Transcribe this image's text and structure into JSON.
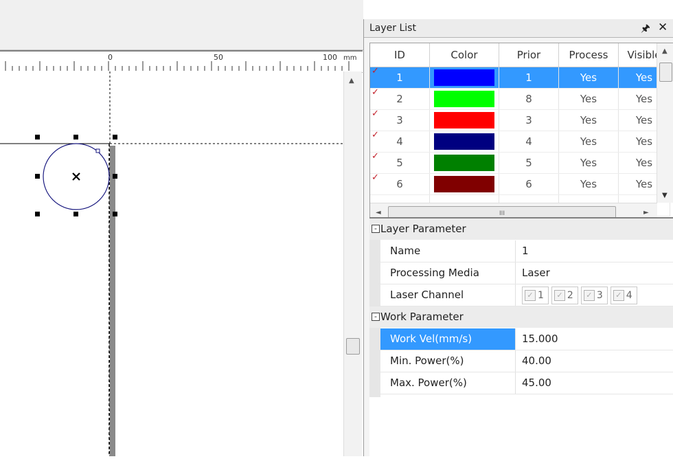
{
  "ruler": {
    "labels": [
      "0",
      "50",
      "100"
    ],
    "unit": "mm"
  },
  "panel": {
    "title": "Layer List",
    "pin_icon": "pin-icon",
    "close_icon": "close-icon"
  },
  "layer_table": {
    "columns": [
      "ID",
      "Color",
      "Prior",
      "Process",
      "Visible"
    ],
    "rows": [
      {
        "id": "1",
        "color": "#0000ff",
        "prior": "1",
        "process": "Yes",
        "visible": "Yes",
        "selected": true
      },
      {
        "id": "2",
        "color": "#00ff00",
        "prior": "8",
        "process": "Yes",
        "visible": "Yes",
        "selected": false
      },
      {
        "id": "3",
        "color": "#ff0000",
        "prior": "3",
        "process": "Yes",
        "visible": "Yes",
        "selected": false
      },
      {
        "id": "4",
        "color": "#000080",
        "prior": "4",
        "process": "Yes",
        "visible": "Yes",
        "selected": false
      },
      {
        "id": "5",
        "color": "#008000",
        "prior": "5",
        "process": "Yes",
        "visible": "Yes",
        "selected": false
      },
      {
        "id": "6",
        "color": "#800000",
        "prior": "6",
        "process": "Yes",
        "visible": "Yes",
        "selected": false
      }
    ],
    "hscroll_grip": "III"
  },
  "properties": {
    "layer_parameter": {
      "label": "Layer Parameter",
      "toggle": "-",
      "name_label": "Name",
      "name_value": "1",
      "media_label": "Processing Media",
      "media_value": "Laser",
      "channel_label": "Laser Channel",
      "channels": [
        "1",
        "2",
        "3",
        "4"
      ]
    },
    "work_parameter": {
      "label": "Work Parameter",
      "toggle": "-",
      "vel_label": "Work Vel(mm/s)",
      "vel_value": "15.000",
      "min_label": "Min. Power(%)",
      "min_value": "40.00",
      "max_label": "Max. Power(%)",
      "max_value": "45.00"
    }
  },
  "colors": {
    "selection": "#3399ff",
    "check_mark": "#c2202a"
  }
}
